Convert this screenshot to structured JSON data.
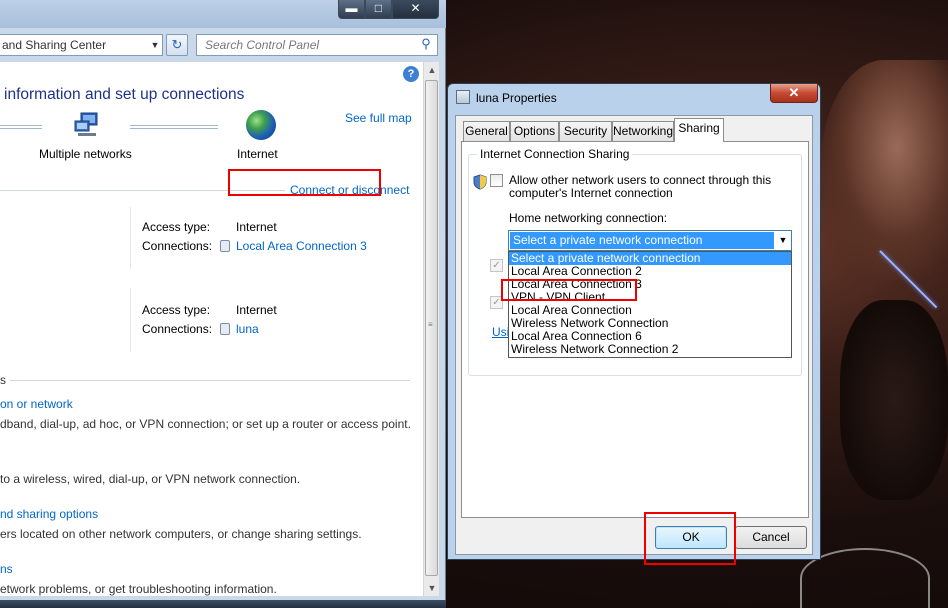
{
  "control_panel": {
    "address_text": "and Sharing Center",
    "search_placeholder": "Search Control Panel",
    "heading": "information and set up connections",
    "see_full_map": "See full map",
    "networks_label": "Multiple networks",
    "internet_label": "Internet",
    "connect_or_disconnect": "Connect or disconnect",
    "network1": {
      "access_type_label": "Access type:",
      "access_type_value": "Internet",
      "connections_label": "Connections:",
      "connection_name": "Local Area Connection 3"
    },
    "network2": {
      "access_type_label": "Access type:",
      "access_type_value": "Internet",
      "connections_label": "Connections:",
      "connection_name": "luna"
    },
    "tasks": {
      "section_fragment": "s",
      "task1_link": "on or network",
      "task1_desc": "dband, dial-up, ad hoc, or VPN connection; or set up a router or access point.",
      "task2_desc": "to a wireless, wired, dial-up, or VPN network connection.",
      "task3_link": "nd sharing options",
      "task3_desc": "ers located on other network computers, or change sharing settings.",
      "task4_link": "ns",
      "task4_desc": "etwork problems, or get troubleshooting information."
    },
    "window_buttons": {
      "minimize": "▬",
      "maximize": "□",
      "close": "✕"
    },
    "help": "?"
  },
  "dialog": {
    "title": "luna Properties",
    "close": "✕",
    "tabs": [
      "General",
      "Options",
      "Security",
      "Networking",
      "Sharing"
    ],
    "active_tab": "Sharing",
    "group_label": "Internet Connection Sharing",
    "allow_text": "Allow other network users to connect through this computer's Internet connection",
    "home_label": "Home networking connection:",
    "select_value": "Select a private network connection",
    "dropdown_options": [
      "Select a private network connection",
      "Local Area Connection 2",
      "Local Area Connection 3",
      "VPN - VPN Client",
      "Local Area Connection",
      "Wireless Network Connection",
      "Local Area Connection 6",
      "Wireless Network Connection 2"
    ],
    "partial_link": "Usi",
    "ok": "OK",
    "cancel": "Cancel"
  },
  "icons": {
    "dropdown_arrow": "▼",
    "scroll_up": "▲",
    "scroll_down": "▼",
    "refresh": "↻",
    "search": "⚲",
    "check": "✓",
    "grip": "≡"
  },
  "colors": {
    "highlight": "#e00000",
    "link": "#0066cc",
    "selection": "#3399ff"
  }
}
